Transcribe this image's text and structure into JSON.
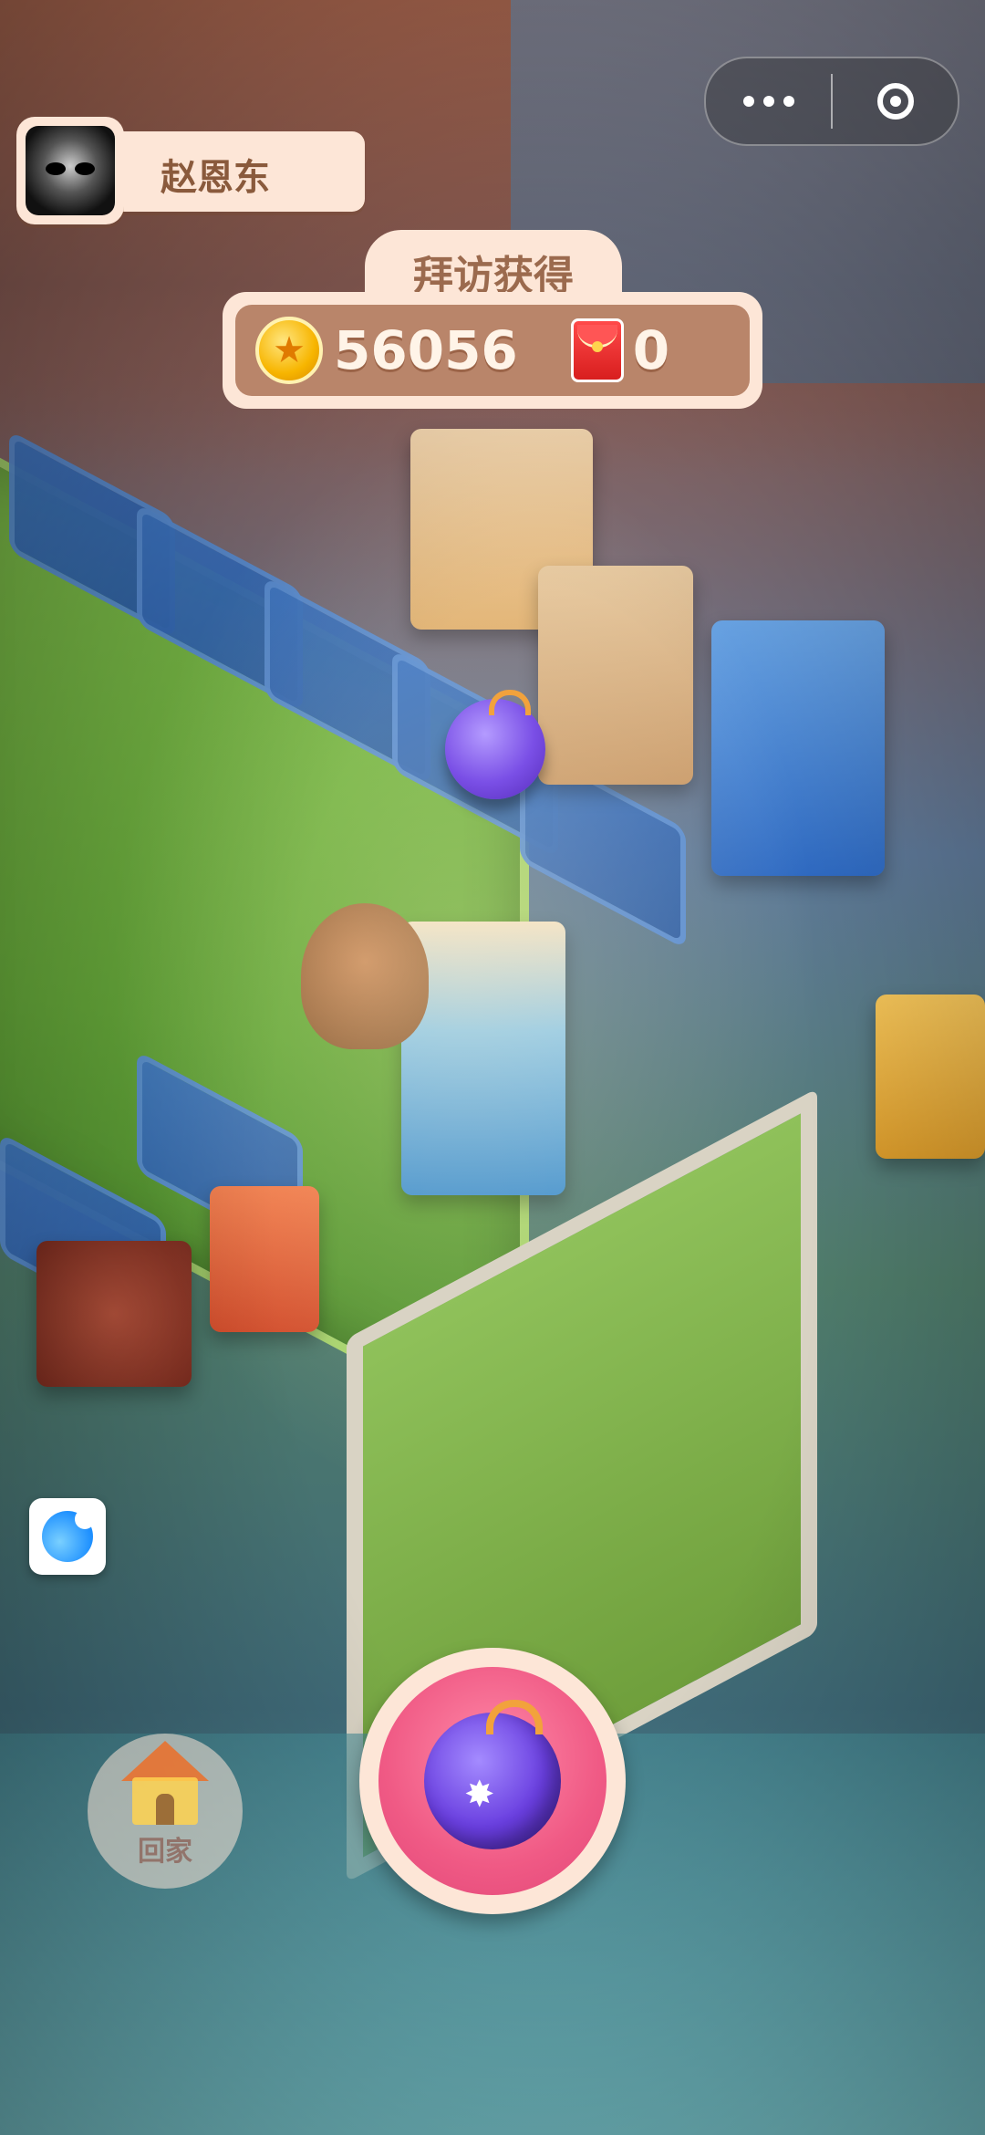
{
  "player": {
    "name": "赵恩东",
    "avatar_icon": "player-avatar"
  },
  "capsule": {
    "more_icon": "more-dots-icon",
    "close_icon": "target-circle-icon"
  },
  "visit_reward": {
    "title": "拜访获得",
    "coins": "56056",
    "coin_icon": "gold-coin-star-icon",
    "red_envelopes": "0",
    "red_envelope_icon": "red-envelope-icon"
  },
  "home_button": {
    "label": "回家",
    "icon": "house-icon"
  },
  "action_button": {
    "icon": "purple-bomb-icon"
  },
  "colors": {
    "panel_bg": "#fde6d7",
    "panel_inner": "#b9856a",
    "title_text": "#9b6a4e",
    "action_pink": "#f05a85",
    "bomb_purple": "#6a3fe0"
  }
}
